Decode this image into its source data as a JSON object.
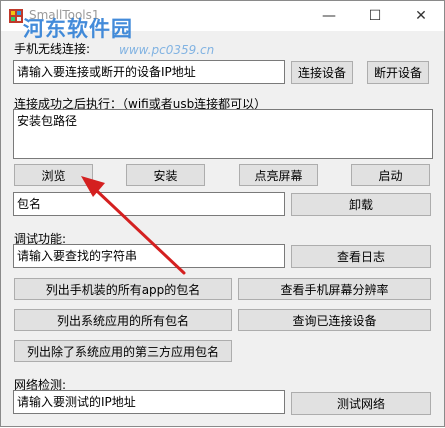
{
  "window": {
    "title": "SmallTools1",
    "watermark": "河东软件园",
    "watermark_url": "www.pc0359.cn",
    "controls": {
      "minimize": "—",
      "maximize": "☐",
      "close": "✕"
    }
  },
  "wifi": {
    "label": "手机无线连接:",
    "input_value": "请输入要连接或断开的设备IP地址",
    "connect_label": "连接设备",
    "disconnect_label": "断开设备"
  },
  "after_connect": {
    "label": "连接成功之后执行：（wifi或者usb连接都可以）",
    "path_value": "安装包路径",
    "browse_label": "浏览",
    "install_label": "安装",
    "light_label": "点亮屏幕",
    "start_label": "启动",
    "package_value": "包名",
    "uninstall_label": "卸载"
  },
  "debug": {
    "label": "调试功能:",
    "search_value": "请输入要查找的字符串",
    "view_log_label": "查看日志",
    "list_all_label": "列出手机装的所有app的包名",
    "resolution_label": "查看手机屏幕分辨率",
    "list_system_label": "列出系统应用的所有包名",
    "query_devices_label": "查询已连接设备",
    "list_third_label": "列出除了系统应用的第三方应用包名"
  },
  "network": {
    "label": "网络检测:",
    "ip_value": "请输入要测试的IP地址",
    "test_label": "测试网络"
  },
  "colors": {
    "arrow": "#d42020",
    "watermark": "#2f7fd6"
  }
}
